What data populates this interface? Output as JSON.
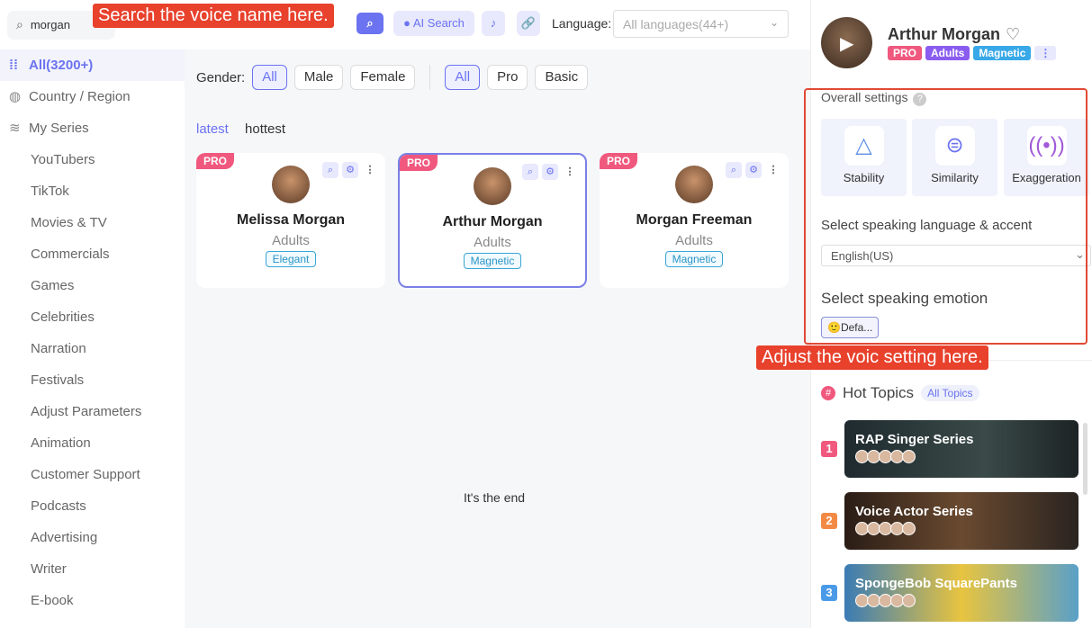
{
  "search": {
    "value": "morgan",
    "button_icon": "search-icon"
  },
  "annotations": {
    "search_callout": "Search the voice name here.",
    "settings_callout": "Adjust the voic setting here."
  },
  "toolbar": {
    "ai_search": "AI Search",
    "language_label": "Language:",
    "language_placeholder": "All languages(44+)"
  },
  "sidebar": {
    "items": [
      {
        "label": "All(3200+)",
        "icon": "grid-icon"
      },
      {
        "label": "Country / Region",
        "icon": "globe-icon"
      },
      {
        "label": "My Series",
        "icon": "layers-icon"
      },
      {
        "label": "YouTubers"
      },
      {
        "label": "TikTok"
      },
      {
        "label": "Movies & TV"
      },
      {
        "label": "Commercials"
      },
      {
        "label": "Games"
      },
      {
        "label": "Celebrities"
      },
      {
        "label": "Narration"
      },
      {
        "label": "Festivals"
      },
      {
        "label": "Adjust Parameters"
      },
      {
        "label": "Animation"
      },
      {
        "label": "Customer Support"
      },
      {
        "label": "Podcasts"
      },
      {
        "label": "Advertising"
      },
      {
        "label": "Writer"
      },
      {
        "label": "E-book"
      }
    ]
  },
  "filters": {
    "gender_label": "Gender:",
    "gender": [
      "All",
      "Male",
      "Female"
    ],
    "tier": [
      "All",
      "Pro",
      "Basic"
    ]
  },
  "sort": [
    "latest",
    "hottest"
  ],
  "voices": [
    {
      "badge": "PRO",
      "name": "Melissa Morgan",
      "age": "Adults",
      "tag": "Elegant"
    },
    {
      "badge": "PRO",
      "name": "Arthur Morgan",
      "age": "Adults",
      "tag": "Magnetic",
      "selected": true
    },
    {
      "badge": "PRO",
      "name": "Morgan Freeman",
      "age": "Adults",
      "tag": "Magnetic"
    }
  ],
  "end_text": "It's the end",
  "profile": {
    "name": "Arthur Morgan",
    "badges": [
      "PRO",
      "Adults",
      "Magnetic"
    ]
  },
  "settings": {
    "overall": "Overall settings",
    "options": [
      "Stability",
      "Similarity",
      "Exaggeration"
    ],
    "language_label": "Select speaking language & accent",
    "language_value": "English(US)",
    "emotion_label": "Select speaking emotion",
    "emotion_value": "Defa..."
  },
  "hot": {
    "title": "Hot Topics",
    "all": "All Topics",
    "topics": [
      {
        "rank": "1",
        "title": "RAP Singer Series"
      },
      {
        "rank": "2",
        "title": "Voice Actor Series"
      },
      {
        "rank": "3",
        "title": "SpongeBob SquarePants"
      }
    ]
  },
  "colors": {
    "accent": "#6b73f0",
    "pro": "#f0587e",
    "callout": "#e8412c"
  }
}
